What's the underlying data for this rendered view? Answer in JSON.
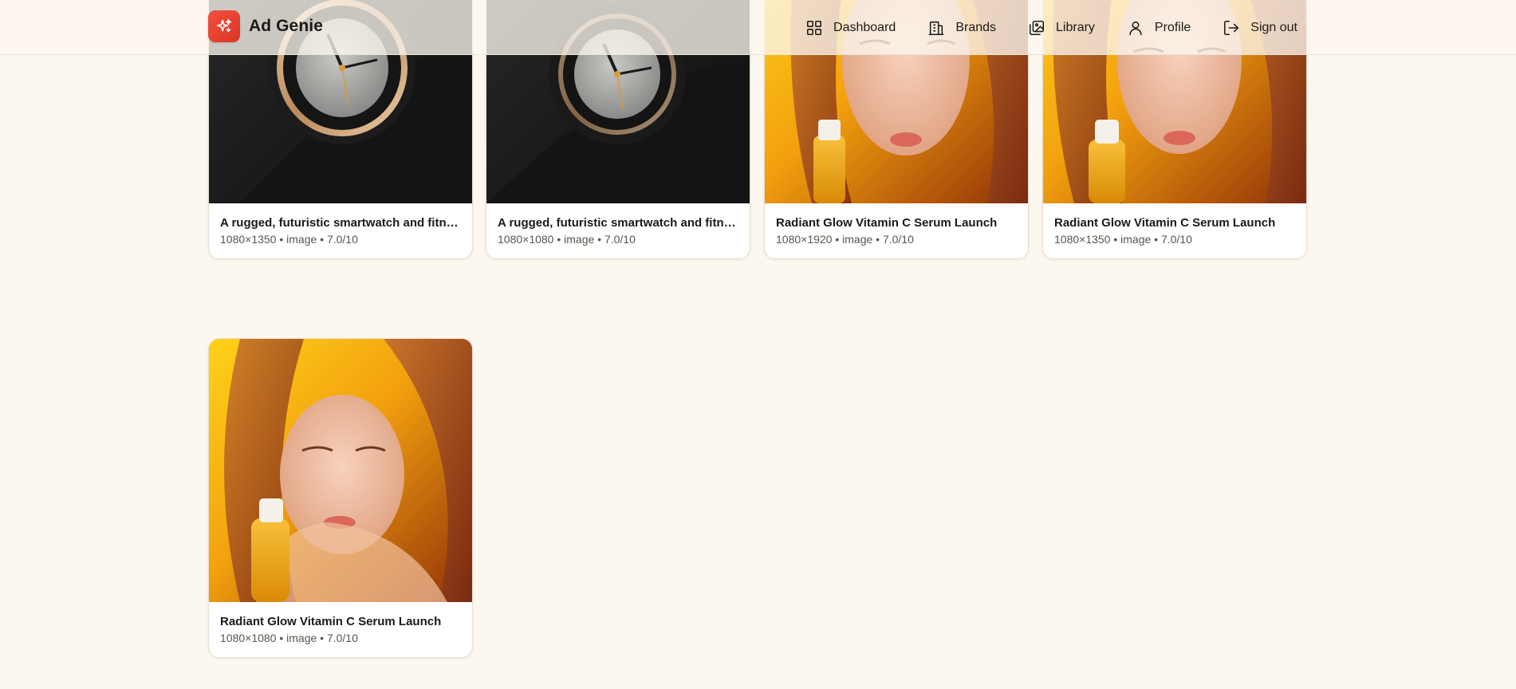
{
  "app": {
    "name": "Ad Genie",
    "logo_icon": "sparkles-icon",
    "accent": "#e8412f"
  },
  "nav": [
    {
      "label": "Dashboard",
      "icon": "dashboard-grid-icon"
    },
    {
      "label": "Brands",
      "icon": "building-icon"
    },
    {
      "label": "Library",
      "icon": "image-stack-icon"
    },
    {
      "label": "Profile",
      "icon": "user-icon"
    },
    {
      "label": "Sign out",
      "icon": "log-out-icon"
    }
  ],
  "assets": [
    {
      "title": "A rugged, futuristic smartwatch and fitness tracker",
      "details": "1080×1350 • image • 7.0/10"
    },
    {
      "title": "A rugged, futuristic smartwatch and fitness tracker",
      "details": "1080×1080 • image • 7.0/10"
    },
    {
      "title": "Radiant Glow Vitamin C Serum Launch",
      "details": "1080×1920 • image • 7.0/10"
    },
    {
      "title": "Radiant Glow Vitamin C Serum Launch",
      "details": "1080×1350 • image • 7.0/10"
    },
    {
      "title": "Radiant Glow Vitamin C Serum Launch",
      "details": "1080×1080 • image • 7.0/10"
    }
  ]
}
